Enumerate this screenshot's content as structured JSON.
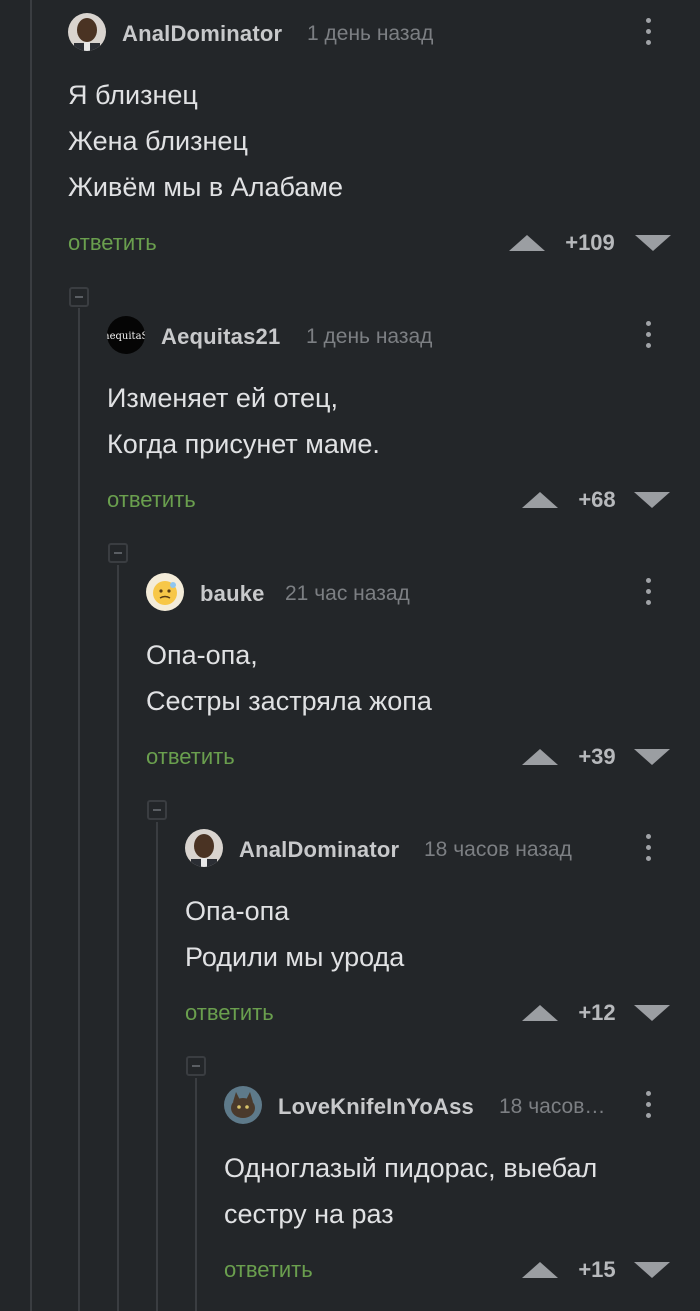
{
  "comments": [
    {
      "username": "AnalDominator",
      "time": "1 день назад",
      "lines": [
        "Я близнец",
        "Жена близнец",
        "Живём мы в Алабаме"
      ],
      "reply": "ответить",
      "score": "+109",
      "avatar_icon": "avatar-man"
    },
    {
      "username": "Aequitas21",
      "time": "1 день назад",
      "lines": [
        "Изменяет ей отец,",
        "Когда присунет маме."
      ],
      "reply": "ответить",
      "score": "+68",
      "avatar_icon": "avatar-aequitas",
      "avatar_logo_text": "aequitaS"
    },
    {
      "username": "bauke",
      "time": "21 час назад",
      "lines": [
        "Опа-опа,",
        "Сестры застряла жопа"
      ],
      "reply": "ответить",
      "score": "+39",
      "avatar_icon": "avatar-emoji"
    },
    {
      "username": "AnalDominator",
      "time": "18 часов назад",
      "lines": [
        "Опа-опа",
        "Родили мы урода"
      ],
      "reply": "ответить",
      "score": "+12",
      "avatar_icon": "avatar-man"
    },
    {
      "username": "LoveKnifeInYoAss",
      "time": "18 часов…",
      "lines": [
        "Одноглазый пидорас, выебал",
        "сестру на раз"
      ],
      "reply": "ответить",
      "score": "+15",
      "avatar_icon": "avatar-cat"
    }
  ],
  "colors": {
    "background": "#232629",
    "reply_green": "#6a9f4e",
    "thread_line": "#3a3d41"
  }
}
